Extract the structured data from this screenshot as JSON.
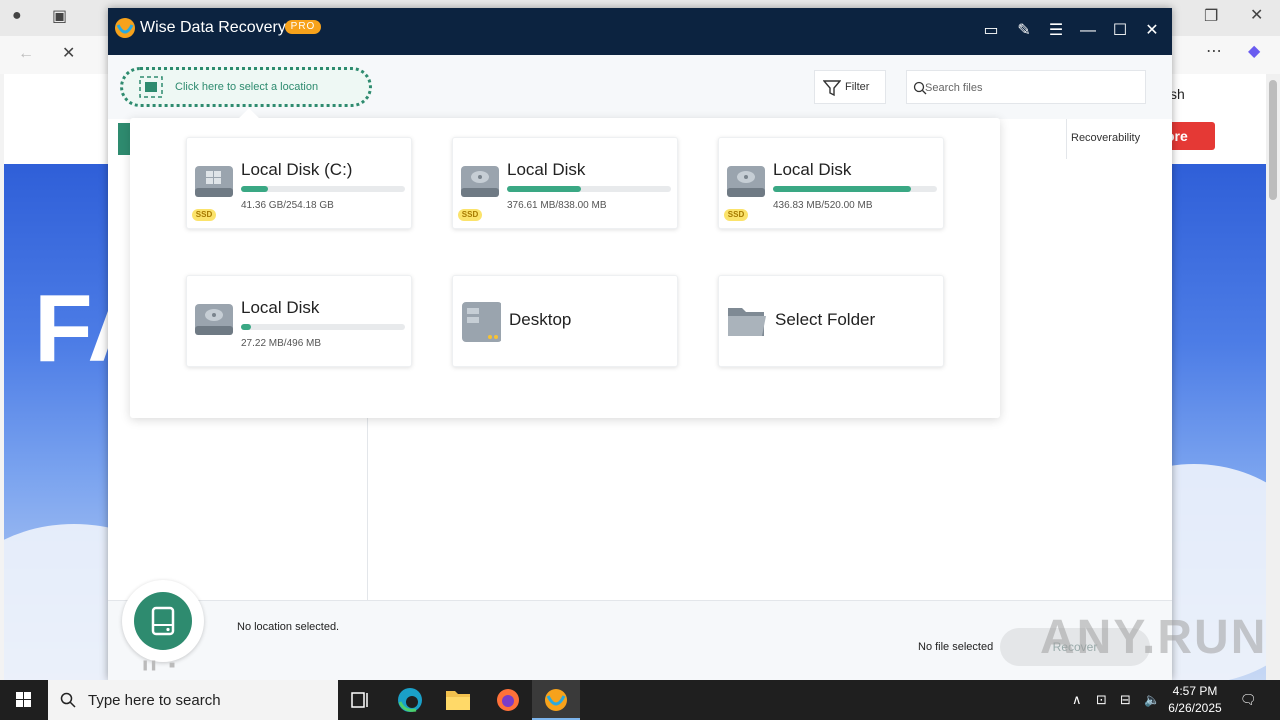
{
  "app": {
    "title": "Wise Data Recovery",
    "badge": "PRO",
    "location_button": "Click here to select a location",
    "filter_label": "Filter",
    "search_placeholder": "Search files",
    "column_recoverability": "Recoverability",
    "status": "No location selected.",
    "no_file": "No file selected",
    "recover_label": "Recover",
    "accent_color": "#2e8b6f",
    "titlebar_color": "#0c2340"
  },
  "locations": [
    {
      "name": "Local Disk (C:)",
      "size": "41.36 GB/254.18 GB",
      "fill": 0.163,
      "ssd": "SSD",
      "icon": "windows-drive-icon"
    },
    {
      "name": "Local Disk",
      "size": "376.61 MB/838.00 MB",
      "fill": 0.449,
      "ssd": "SSD",
      "icon": "hard-drive-icon"
    },
    {
      "name": "Local Disk",
      "size": "436.83 MB/520.00 MB",
      "fill": 0.84,
      "ssd": "SSD",
      "icon": "hard-drive-icon"
    },
    {
      "name": "Local Disk",
      "size": "27.22 MB/496 MB",
      "fill": 0.055,
      "icon": "hard-drive-icon"
    },
    {
      "name": "Desktop",
      "icon": "desktop-icon"
    },
    {
      "name": "Select Folder",
      "icon": "folder-icon"
    }
  ],
  "browser": {
    "hero_text": "FA",
    "lang_text": "sh",
    "more_label": "ore"
  },
  "taskbar": {
    "search_placeholder": "Type here to search",
    "time": "4:57 PM",
    "date": "6/26/2025"
  },
  "watermark": "ANY.RUN"
}
